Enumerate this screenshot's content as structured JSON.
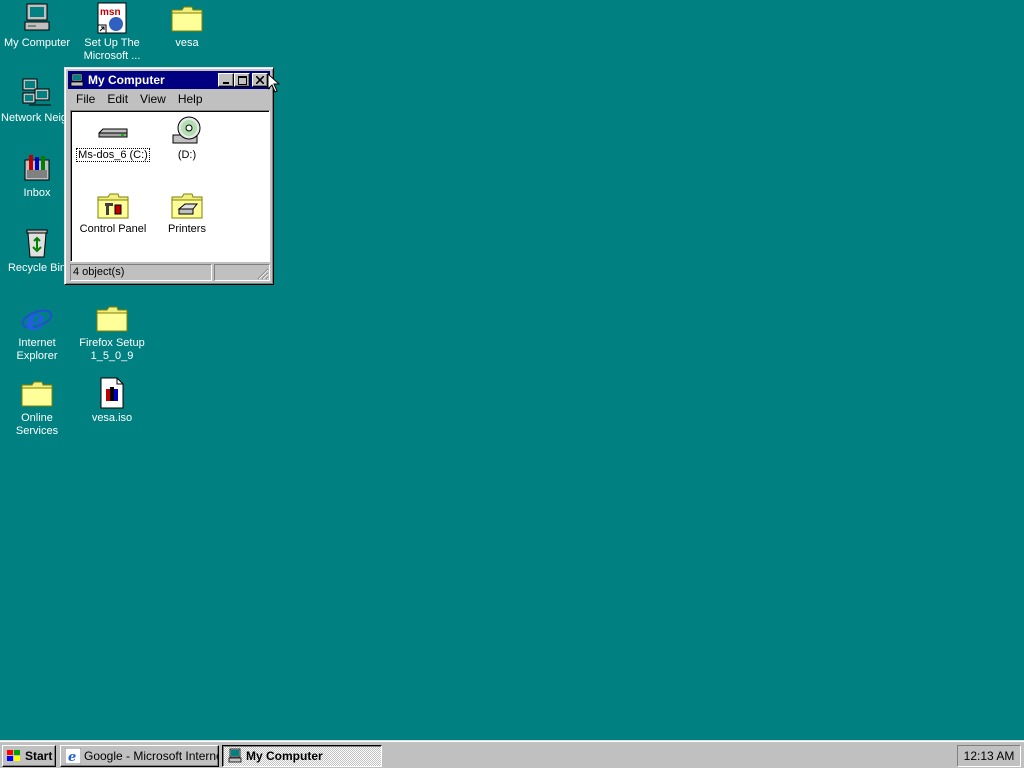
{
  "desktop": {
    "icons": [
      {
        "label": "My Computer",
        "icon": "my-computer-icon"
      },
      {
        "label": "Set Up The\nMicrosoft ...",
        "icon": "msn-setup-icon"
      },
      {
        "label": "vesa",
        "icon": "folder-icon"
      },
      {
        "label": "Network\nNeighborhood",
        "icon": "network-icon"
      },
      {
        "label": "Inbox",
        "icon": "inbox-icon"
      },
      {
        "label": "Recycle Bin",
        "icon": "recycle-bin-icon"
      },
      {
        "label": "Internet\nExplorer",
        "icon": "ie-icon"
      },
      {
        "label": "Firefox Setup\n1_5_0_9",
        "icon": "folder-icon"
      },
      {
        "label": "Online\nServices",
        "icon": "folder-icon"
      },
      {
        "label": "vesa.iso",
        "icon": "iso-file-icon"
      }
    ]
  },
  "window": {
    "title": "My Computer",
    "menu": [
      "File",
      "Edit",
      "View",
      "Help"
    ],
    "items": [
      {
        "label": "Ms-dos_6 (C:)",
        "icon": "hard-drive-icon",
        "selected": true
      },
      {
        "label": "(D:)",
        "icon": "cd-drive-icon",
        "selected": false
      },
      {
        "label": "Control Panel",
        "icon": "control-panel-folder-icon",
        "selected": false
      },
      {
        "label": "Printers",
        "icon": "printers-folder-icon",
        "selected": false
      }
    ],
    "status": "4 object(s)"
  },
  "taskbar": {
    "start_label": "Start",
    "tasks": [
      {
        "label": "Google - Microsoft Internet...",
        "active": false
      },
      {
        "label": "My Computer",
        "active": true
      }
    ],
    "clock": "12:13 AM"
  },
  "colors": {
    "desktop": "#008080",
    "titlebar": "#000080",
    "face": "#c0c0c0"
  }
}
